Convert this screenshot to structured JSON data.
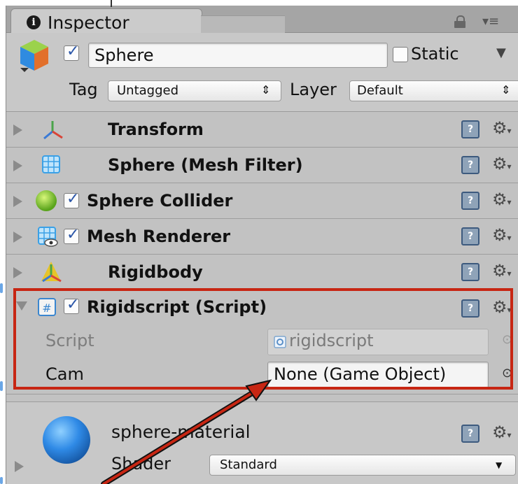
{
  "tab": {
    "title": "Inspector",
    "info_icon": "info-icon"
  },
  "header": {
    "object_name": "Sphere",
    "active_checked": true,
    "static_label": "Static",
    "static_checked": false,
    "tag_label": "Tag",
    "tag_value": "Untagged",
    "layer_label": "Layer",
    "layer_value": "Default"
  },
  "components": [
    {
      "label": "Transform",
      "icon": "transform-axes-icon",
      "has_checkbox": false
    },
    {
      "label": "Sphere (Mesh Filter)",
      "icon": "mesh-filter-icon",
      "has_checkbox": false
    },
    {
      "label": "Sphere Collider",
      "icon": "sphere-collider-icon",
      "has_checkbox": true,
      "checked": true
    },
    {
      "label": "Mesh Renderer",
      "icon": "mesh-renderer-icon",
      "has_checkbox": true,
      "checked": true
    },
    {
      "label": "Rigidbody",
      "icon": "rigidbody-icon",
      "has_checkbox": false
    }
  ],
  "script_component": {
    "label": "Rigidscript (Script)",
    "checked": true,
    "script_label": "Script",
    "script_value": "rigidscript",
    "cam_label": "Cam",
    "cam_value": "None (Game Object)"
  },
  "material": {
    "name": "sphere-material",
    "shader_label": "Shader",
    "shader_value": "Standard"
  },
  "colors": {
    "highlight": "#c72613",
    "checkbox_tick": "#2b56a8",
    "panel": "#c2c2c2"
  }
}
